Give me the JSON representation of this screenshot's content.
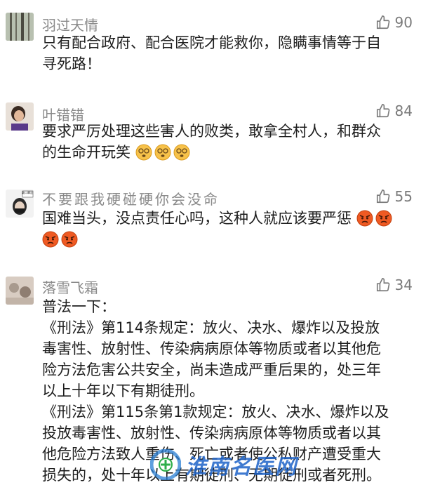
{
  "comments": [
    {
      "name": "羽过天情",
      "likes": "90",
      "avatar": "forest-trees-avatar",
      "lines": [
        "只有配合政府、配合医院才能救你，隐瞒事情等于自",
        "寻死路！"
      ]
    },
    {
      "name": "叶错错",
      "likes": "84",
      "avatar": "person-portrait-avatar",
      "lines": [
        "要求严厉处理这些害人的败类，敢拿全村人，和群众",
        "的生命开玩笑"
      ],
      "emoji": "dizzy-face-emoji"
    },
    {
      "name": "不要跟我硬碰硬你会没命",
      "likes": "55",
      "avatar": "masked-person-avatar",
      "avatar_caption": "戴口罩没",
      "lines": [
        "国难当头，没点责任心吗，这种人就应该要严惩"
      ],
      "emoji": "angry-face-emoji"
    },
    {
      "name": "落雪飞霜",
      "likes": "34",
      "avatar": "blurry-photo-avatar",
      "lines": [
        "普法一下：",
        "《刑法》第114条规定：放火、决水、爆炸以及投放",
        "毒害性、放射性、传染病病原体等物质或者以其他危",
        "险方法危害公共安全，尚未造成严重后果的，处三年",
        "以上十年以下有期徒刑。",
        "《刑法》第115条第1款规定：放火、决水、爆炸以及",
        "投放毒害性、放射性、传染病病原体等物质或者以其",
        "他危险方法致人重伤、死亡或者使公私财产遭受重大",
        "损失的，处十年以上有期徒刑、无期徒刑或者死刑。"
      ]
    }
  ],
  "watermark": "淮南名医网",
  "colors": {
    "name": "#8a8a8a",
    "text": "#1e1e1e",
    "emoji": "#f5a623",
    "angry": "#e8501f"
  }
}
